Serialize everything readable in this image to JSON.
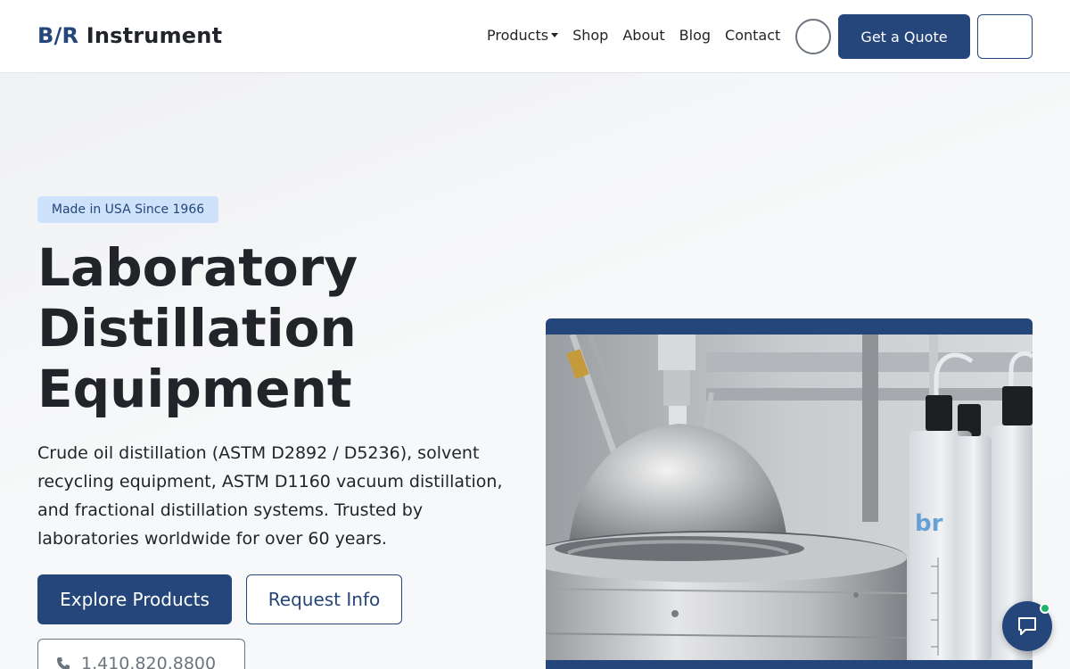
{
  "header": {
    "brand_accent": "B/R",
    "brand_name": "Instrument",
    "nav": [
      {
        "label": "Products",
        "has_dropdown": true
      },
      {
        "label": "Shop"
      },
      {
        "label": "About"
      },
      {
        "label": "Blog"
      },
      {
        "label": "Contact"
      }
    ],
    "quote_label": "Get a Quote"
  },
  "hero": {
    "badge": "Made in USA Since 1966",
    "title_line1": "Laboratory",
    "title_line2": "Distillation",
    "title_line3": "Equipment",
    "description": "Crude oil distillation (ASTM D2892 / D5236), solvent recycling equipment, ASTM D1160 vacuum distillation, and fractional distillation systems. Trusted by laboratories worldwide for over 60 years.",
    "primary_cta": "Explore Products",
    "secondary_cta": "Request Info",
    "phone": "1.410.820.8800"
  },
  "photo": {
    "icon": "distillation-apparatus-photo"
  },
  "chat": {
    "icon": "chat-bubble-icon",
    "status": "online"
  },
  "colors": {
    "brand": "#25467a",
    "badge_bg": "#cfe2fb",
    "status_online": "#22b36b"
  }
}
